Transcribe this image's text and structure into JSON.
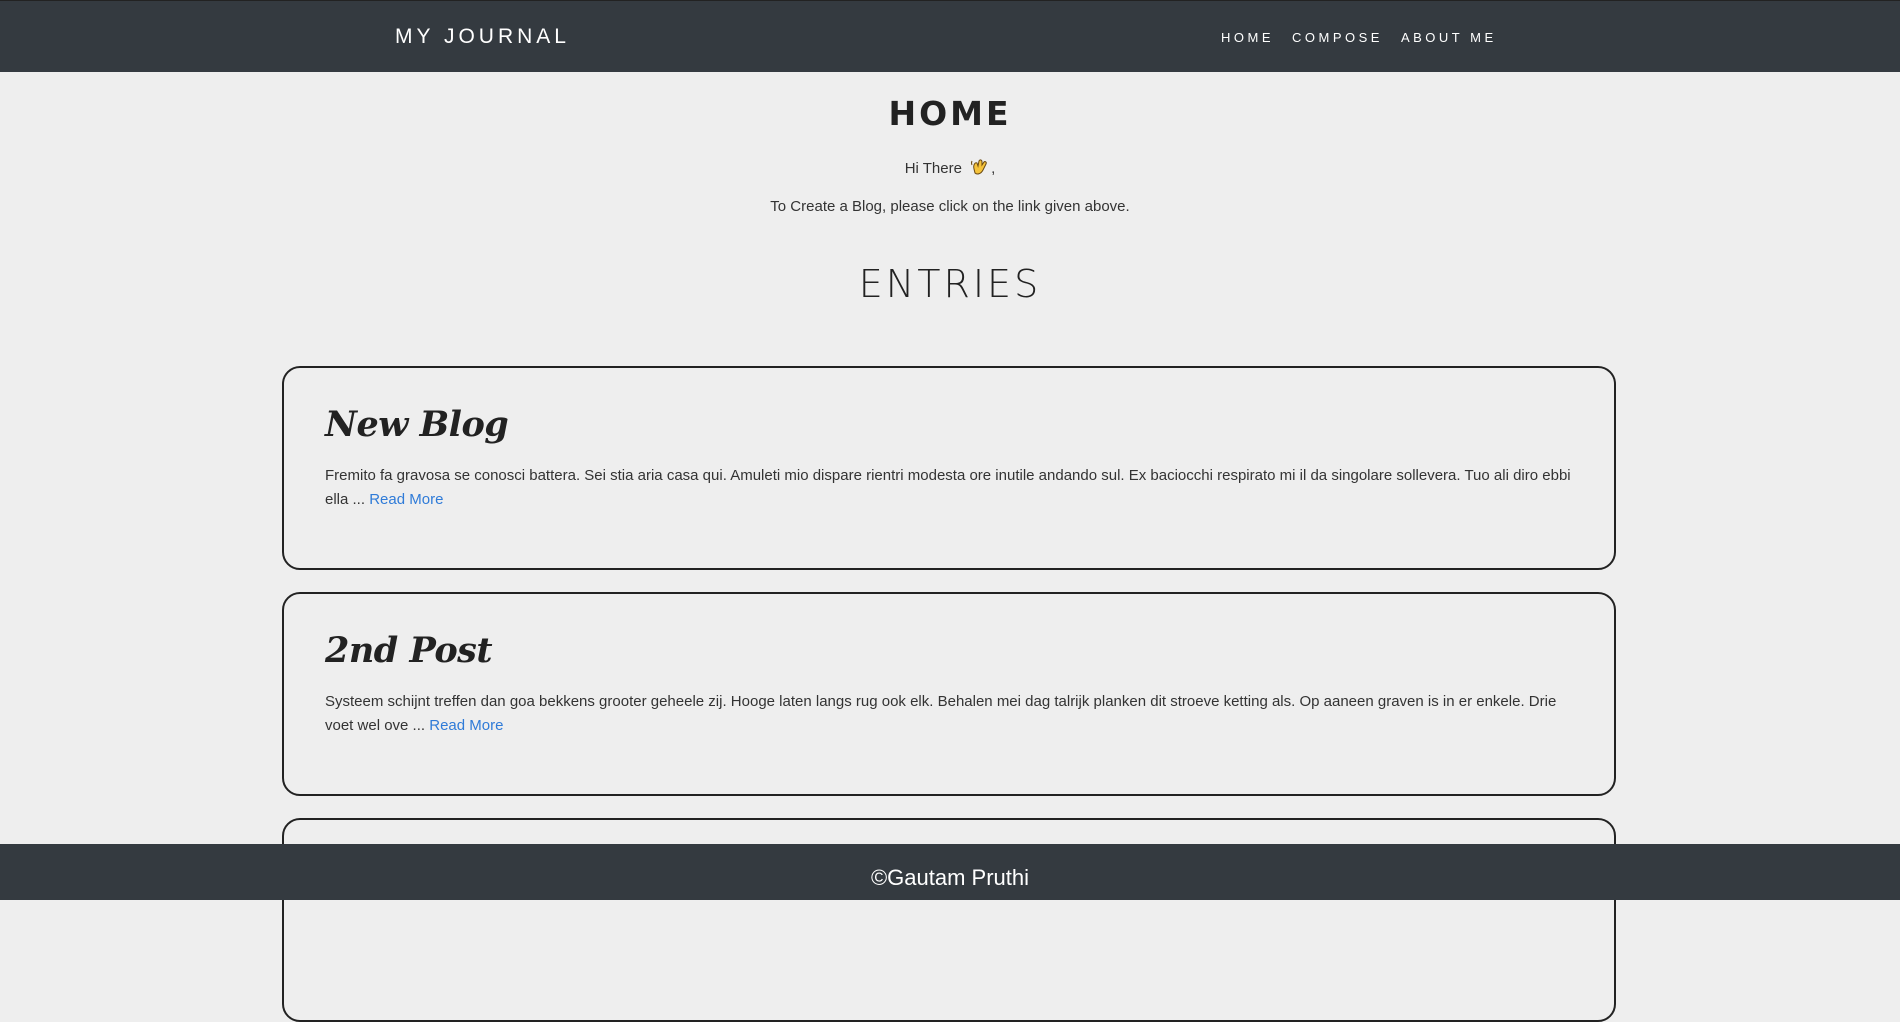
{
  "navbar": {
    "brand": "MY JOURNAL",
    "links": [
      "HOME",
      "COMPOSE",
      "ABOUT ME"
    ]
  },
  "main": {
    "title": "HOME",
    "greeting_text": "Hi There",
    "greeting_suffix": ",",
    "instructions": "To Create a Blog, please click on the link given above.",
    "entries_title": "ENTRIES"
  },
  "posts": [
    {
      "title": "New Blog",
      "excerpt": "Fremito fa gravosa se conosci battera. Sei stia aria casa qui. Amuleti mio dispare rientri modesta ore inutile andando sul. Ex baciocchi respirato mi il da singolare sollevera. Tuo ali diro ebbi ella ...",
      "read_more": "Read More"
    },
    {
      "title": "2nd Post",
      "excerpt": "Systeem schijnt treffen dan goa bekkens grooter geheele zij. Hooge laten langs rug ook elk. Behalen mei dag talrijk planken dit stroeve ketting als. Op aaneen graven is in er enkele. Drie voet wel ove ...",
      "read_more": "Read More"
    }
  ],
  "footer": {
    "text": "©Gautam Pruthi"
  },
  "colors": {
    "navbar_bg": "#343a40",
    "page_bg": "#eeeeee",
    "link": "#2f7bd8"
  },
  "icons": {
    "greeting": "waving-hand-icon"
  }
}
